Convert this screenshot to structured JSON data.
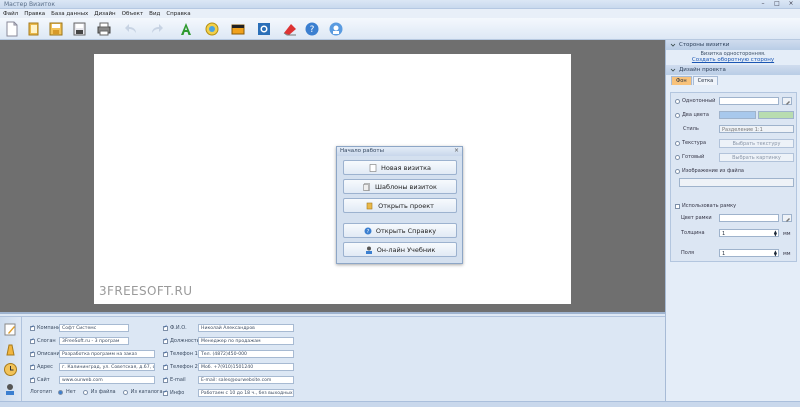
{
  "window": {
    "title": "Мастер Визиток",
    "controls": [
      "–",
      "□",
      "×"
    ]
  },
  "menu": [
    "Файл",
    "Правка",
    "База данных",
    "Дизайн",
    "Объект",
    "Вид",
    "Справка"
  ],
  "toolbar": [
    {
      "icon": "new-document-icon"
    },
    {
      "icon": "open-folder-icon"
    },
    {
      "icon": "save-icon"
    },
    {
      "icon": "save-as-icon"
    },
    {
      "icon": "print-icon"
    },
    {
      "icon": "undo-icon"
    },
    {
      "icon": "redo-icon"
    },
    {
      "icon": "text-icon"
    },
    {
      "icon": "image-icon"
    },
    {
      "icon": "background-icon"
    },
    {
      "icon": "zoom-icon"
    },
    {
      "icon": "delete-icon"
    },
    {
      "icon": "help-icon"
    },
    {
      "icon": "tutorial-icon"
    }
  ],
  "canvas": {
    "watermark": "3FREESOFT.RU",
    "background": "#6f6f6f"
  },
  "start_dialog": {
    "title": "Начало работы",
    "close": "×",
    "buttons": {
      "new": "Новая визитка",
      "templates": "Шаблоны визиток",
      "open": "Открыть проект",
      "help": "Открыть Справку",
      "tutorial": "Он-лайн Учебник"
    }
  },
  "right_panel": {
    "sides_header": "Стороны визитки",
    "sides_info": "Визитка односторонняя.",
    "sides_link": "Создать оборотную сторону",
    "design_header": "Дизайн проекта",
    "tabs": [
      "Фон",
      "Сетка"
    ],
    "bg": {
      "solid": "Однотонный",
      "two_colors": "Два цвета",
      "style_label": "Стиль",
      "style_value": "Разделение 1:1",
      "texture": "Текстура",
      "texture_btn": "Выбрать текстуру",
      "ready": "Готовый",
      "ready_btn": "Выбрать картинку",
      "from_file": "Изображение из файла",
      "use_frame": "Использовать рамку",
      "frame_color": "Цвет рамки",
      "thickness": "Толщина",
      "thickness_value": "1",
      "margins": "Поля",
      "margins_value": "1",
      "unit": "мм",
      "color1": "#a8c8ec",
      "color2": "#b8dcb0"
    }
  },
  "bottom_form": {
    "left": [
      {
        "label": "Компания",
        "value": "Софт Системс"
      },
      {
        "label": "Слоган",
        "value": "3FreeSoft.ru - 3 програм"
      },
      {
        "label": "Описание",
        "value": "Разработка программ на заказ"
      },
      {
        "label": "Адрес",
        "value": "г. Калининград, ул. Советская, д.67, оф.30"
      },
      {
        "label": "Сайт",
        "value": "www.ourweb.com"
      }
    ],
    "logo": {
      "label": "Логотип",
      "options": [
        "Нет",
        "Из файла",
        "Из каталога"
      ]
    },
    "right": [
      {
        "label": "Ф.И.О.",
        "value": "Николай Александров"
      },
      {
        "label": "Должность",
        "value": "Менеджер по продажам"
      },
      {
        "label": "Телефон 1",
        "value": "Тел. (4872)450-000"
      },
      {
        "label": "Телефон 2",
        "value": "Моб. +7(910)1501240"
      },
      {
        "label": "E-mail",
        "value": "E-mail: sales@ourwebsite.com"
      },
      {
        "label": "Инфо",
        "value": "Работаем с 10 до 18 ч., без выходных"
      }
    ]
  }
}
